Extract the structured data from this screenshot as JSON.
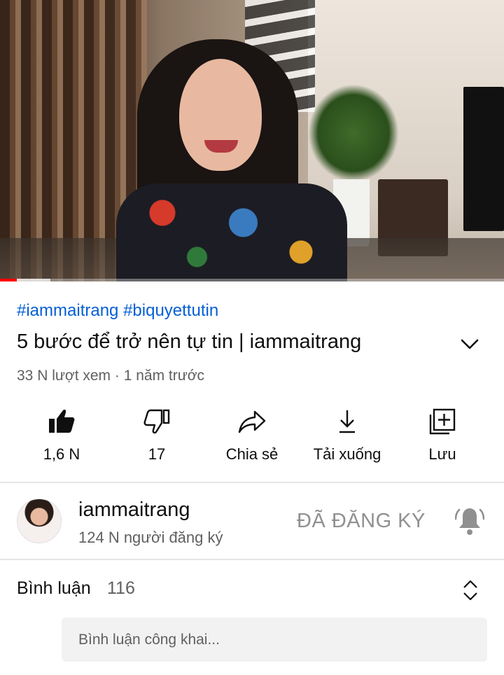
{
  "player": {
    "progress_played": 0.033,
    "progress_buffered_end": 0.1,
    "accent_color": "#ff0000"
  },
  "video": {
    "hashtags": "#iammaitrang #biquyettutin",
    "title": "5 bước để trở nên tự tin | iammaitrang",
    "meta": "33 N lượt xem · 1 năm trước"
  },
  "actions": {
    "like": {
      "label": "1,6 N",
      "icon": "thumb-up-icon"
    },
    "dislike": {
      "label": "17",
      "icon": "thumb-down-icon"
    },
    "share": {
      "label": "Chia sẻ",
      "icon": "share-icon"
    },
    "download": {
      "label": "Tải xuống",
      "icon": "download-icon"
    },
    "save": {
      "label": "Lưu",
      "icon": "save-playlist-icon"
    }
  },
  "channel": {
    "name": "iammaitrang",
    "subscribers": "124 N người đăng ký",
    "subscribe_state": "ĐÃ ĐĂNG KÝ"
  },
  "comments": {
    "label": "Bình luận",
    "count": "116",
    "placeholder": "Bình luận công khai..."
  },
  "colors": {
    "link": "#065fd4",
    "text": "#0f0f0f",
    "secondary": "#606060",
    "subscribed": "#909090"
  }
}
